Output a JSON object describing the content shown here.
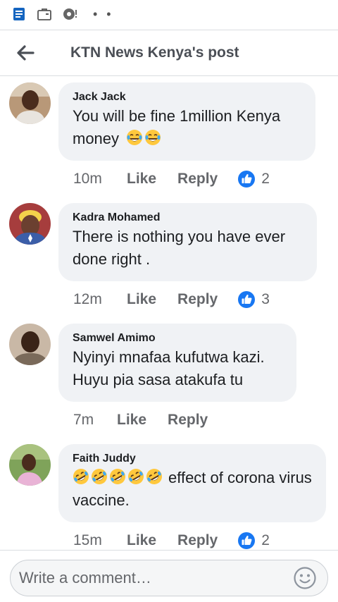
{
  "status_bar": {
    "icons": [
      "notes-app-icon",
      "briefcase-icon",
      "sync-warning-icon"
    ],
    "overflow": "• •"
  },
  "header": {
    "title": "KTN News Kenya's post",
    "back_icon": "arrow-left-icon"
  },
  "comments": [
    {
      "author": "Jack Jack",
      "text": "You will be fine 1million Kenya money",
      "emojis": [
        "face-with-tears-of-joy",
        "face-with-tears-of-joy"
      ],
      "time": "10m",
      "like_label": "Like",
      "reply_label": "Reply",
      "reaction_count": "2"
    },
    {
      "author": "Kadra Mohamed",
      "text": "There is nothing you have ever done right .",
      "emojis": [],
      "time": "12m",
      "like_label": "Like",
      "reply_label": "Reply",
      "reaction_count": "3"
    },
    {
      "author": "Samwel Amimo",
      "text": "Nyinyi mnafaa kufutwa kazi. Huyu pia sasa atakufa tu",
      "emojis": [],
      "time": "7m",
      "like_label": "Like",
      "reply_label": "Reply",
      "reaction_count": ""
    },
    {
      "author": "Faith Juddy",
      "text": "effect of corona virus vaccine.",
      "emojis": [
        "rolling-on-the-floor-laughing",
        "rolling-on-the-floor-laughing",
        "rolling-on-the-floor-laughing",
        "rolling-on-the-floor-laughing",
        "rolling-on-the-floor-laughing"
      ],
      "time": "15m",
      "like_label": "Like",
      "reply_label": "Reply",
      "reaction_count": "2"
    }
  ],
  "composer": {
    "placeholder": "Write a comment…",
    "emoji_icon": "smiley-face-icon"
  },
  "colors": {
    "like_blue": "#1877f2",
    "bubble_bg": "#f0f2f5",
    "secondary_text": "#65676b"
  }
}
